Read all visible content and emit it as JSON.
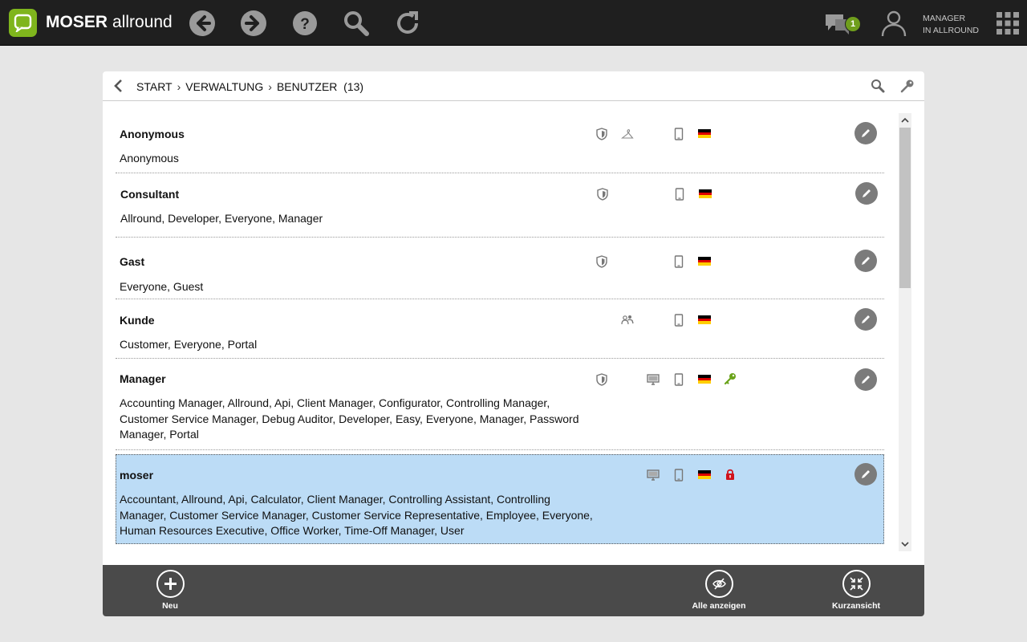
{
  "app": {
    "brand_bold": "MOSER",
    "brand_light": "allround"
  },
  "topbar": {
    "chat_badge": "1",
    "user_role_line1": "MANAGER",
    "user_role_line2": "IN ALLROUND"
  },
  "breadcrumb": {
    "items": [
      "START",
      "VERWALTUNG",
      "BENUTZER"
    ],
    "count": "(13)",
    "separator": "›"
  },
  "colors": {
    "brand_green": "#7fb51d",
    "selected_row": "#bcdcf6",
    "key_green": "#6aa31a",
    "lock_red": "#d0121b"
  },
  "rows": [
    {
      "name": "Anonymous",
      "groups": "Anonymous"
    },
    {
      "name": "Consultant",
      "groups": "Allround, Developer, Everyone, Manager"
    },
    {
      "name": "Gast",
      "groups": "Everyone, Guest"
    },
    {
      "name": "Kunde",
      "groups": "Customer, Everyone, Portal"
    },
    {
      "name": "Manager",
      "groups": "Accounting Manager, Allround, Api, Client Manager, Configurator, Controlling Manager, Customer Service Manager, Debug Auditor, Developer, Easy, Everyone, Manager, Password Manager, Portal"
    },
    {
      "name": "moser",
      "groups": "Accountant, Allround, Api, Calculator, Client Manager, Controlling Assistant, Controlling Manager, Customer Service Manager, Customer Service Representative, Employee, Everyone, Human Resources Executive, Office Worker, Time-Off Manager, User"
    }
  ],
  "footer": {
    "new_label": "Neu",
    "show_all_label": "Alle anzeigen",
    "compact_label": "Kurzansicht"
  }
}
